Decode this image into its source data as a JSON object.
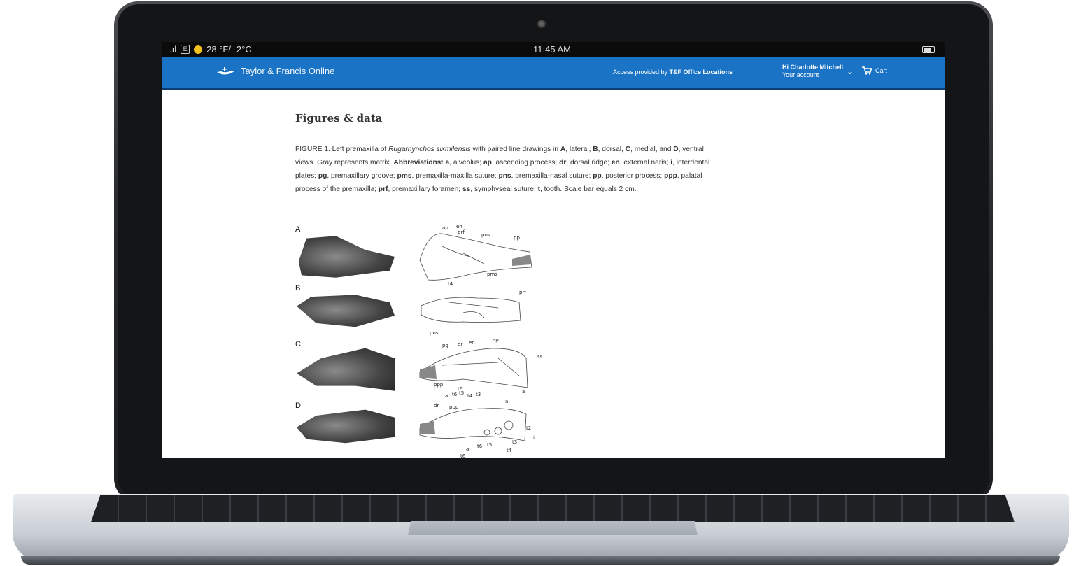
{
  "statusbar": {
    "signal": ".ıl",
    "badge": "E",
    "weather": "28 °F/ -2°C",
    "time": "11:45 AM"
  },
  "header": {
    "logo_text": "Taylor & Francis Online",
    "access_prefix": "Access provided by ",
    "access_org": "T&F Office Locations",
    "greeting": "Hi Charlotte Mitchell",
    "account": "Your account",
    "cart": "Cart"
  },
  "article": {
    "section_title": "Figures & data",
    "caption_html": "FIGURE 1. Left premaxilla of <i>Rugarhynchos sixmilensis</i> with paired line drawings in <b>A</b>, lateral, <b>B</b>, dorsal, <b>C</b>, medial, and <b>D</b>, ventral views. Gray represents matrix. <b>Abbreviations: a</b>, alveolus; <b>ap</b>, ascending process; <b>dr</b>, dorsal ridge; <b>en</b>, external naris; <b>i</b>, interdental plates; <b>pg</b>, premaxillary groove; <b>pms</b>, premaxilla-maxilla suture; <b>pns</b>, premaxilla-nasal suture; <b>pp</b>, posterior process; <b>ppp</b>, palatal process of the premaxilla; <b>prf</b>, premaxillary foramen; <b>ss</b>, symphyseal suture; <b>t</b>, tooth. Scale bar equals 2 cm."
  },
  "figure": {
    "panels": [
      "A",
      "B",
      "C",
      "D"
    ],
    "annotations_A": [
      "ap",
      "en",
      "prf",
      "pns",
      "pp",
      "pms",
      "t4"
    ],
    "annotations_B": [
      "prf",
      "pns"
    ],
    "annotations_C": [
      "ap",
      "pg",
      "dr",
      "en",
      "ss",
      "ppp",
      "t6",
      "a",
      "t6",
      "t5",
      "t4",
      "t3",
      "a"
    ],
    "annotations_D": [
      "dr",
      "ppp",
      "a",
      "t2",
      "t3",
      "t4",
      "t5",
      "t6",
      "a",
      "t6",
      "i"
    ]
  }
}
